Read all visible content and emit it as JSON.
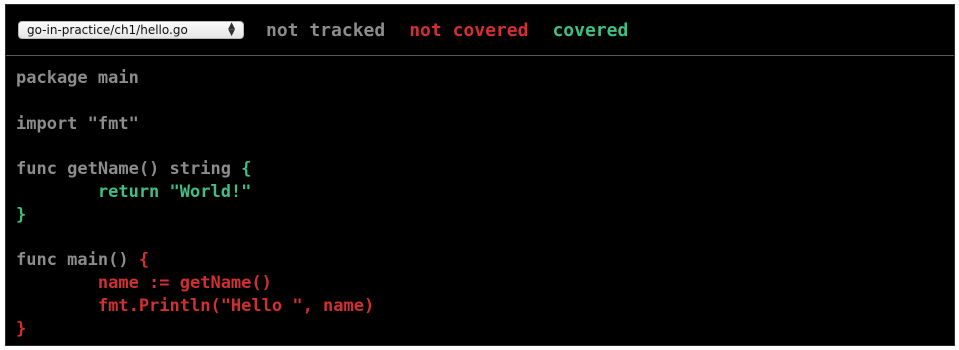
{
  "file_selector": {
    "value": "go-in-practice/ch1/hello.go"
  },
  "legend": {
    "not_tracked": "not tracked",
    "not_covered": "not covered",
    "covered": "covered"
  },
  "colors": {
    "not_tracked": "#8c8c8c",
    "not_covered": "#d13030",
    "covered": "#3fbf84",
    "background": "#000000"
  },
  "code": {
    "lines": [
      {
        "segments": [
          {
            "text": "package main",
            "status": "not_tracked"
          }
        ]
      },
      {
        "segments": []
      },
      {
        "segments": [
          {
            "text": "import \"fmt\"",
            "status": "not_tracked"
          }
        ]
      },
      {
        "segments": []
      },
      {
        "segments": [
          {
            "text": "func getName() string ",
            "status": "not_tracked"
          },
          {
            "text": "{",
            "status": "covered"
          }
        ]
      },
      {
        "segments": [
          {
            "text": "        return \"World!\"",
            "status": "covered"
          }
        ]
      },
      {
        "segments": [
          {
            "text": "}",
            "status": "covered"
          }
        ]
      },
      {
        "segments": []
      },
      {
        "segments": [
          {
            "text": "func main() ",
            "status": "not_tracked"
          },
          {
            "text": "{",
            "status": "not_covered"
          }
        ]
      },
      {
        "segments": [
          {
            "text": "        name := getName()",
            "status": "not_covered"
          }
        ]
      },
      {
        "segments": [
          {
            "text": "        fmt.Println(\"Hello \", name)",
            "status": "not_covered"
          }
        ]
      },
      {
        "segments": [
          {
            "text": "}",
            "status": "not_covered"
          }
        ]
      }
    ]
  }
}
